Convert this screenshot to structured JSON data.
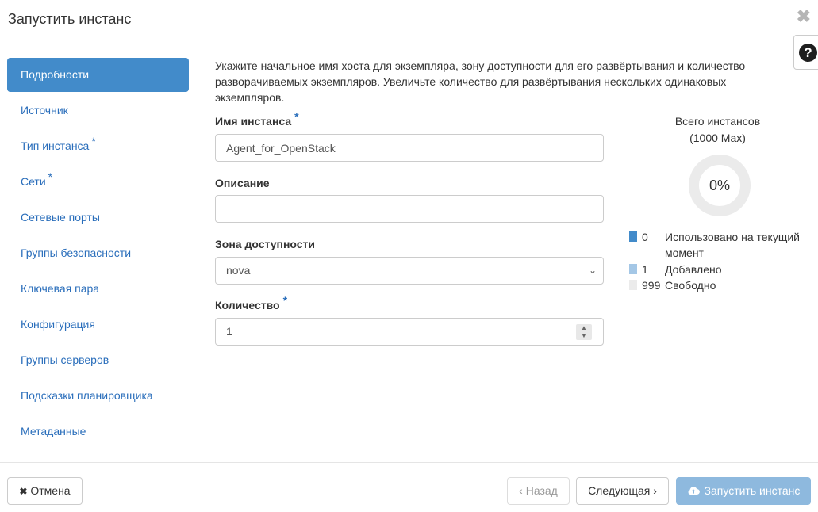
{
  "header": {
    "title": "Запустить инстанс",
    "close_glyph": "✖",
    "help_glyph": "?"
  },
  "sidebar": {
    "items": [
      {
        "label": "Подробности",
        "required": false,
        "active": true
      },
      {
        "label": "Источник",
        "required": false
      },
      {
        "label": "Тип инстанса",
        "required": true
      },
      {
        "label": "Сети",
        "required": true
      },
      {
        "label": "Сетевые порты",
        "required": false
      },
      {
        "label": "Группы безопасности",
        "required": false
      },
      {
        "label": "Ключевая пара",
        "required": false
      },
      {
        "label": "Конфигурация",
        "required": false
      },
      {
        "label": "Группы серверов",
        "required": false
      },
      {
        "label": "Подсказки планировщика",
        "required": false
      },
      {
        "label": "Метаданные",
        "required": false
      }
    ],
    "required_mark": "*"
  },
  "main": {
    "description": "Укажите начальное имя хоста для экземпляра, зону доступности для его развёртывания и количество разворачиваемых экземпляров. Увеличьте количество для развёртывания нескольких одинаковых экземпляров.",
    "fields": {
      "name": {
        "label": "Имя инстанса",
        "required": true,
        "value": "Agent_for_OpenStack"
      },
      "description": {
        "label": "Описание",
        "value": ""
      },
      "zone": {
        "label": "Зона доступности",
        "value": "nova",
        "arrow_glyph": "⌄"
      },
      "count": {
        "label": "Количество",
        "required": true,
        "value": "1",
        "up_glyph": "▲",
        "down_glyph": "▼"
      }
    }
  },
  "quota": {
    "title_line1": "Всего инстансов",
    "title_line2": "(1000 Max)",
    "percent_label": "0%",
    "used_fraction": 0.0,
    "legend": [
      {
        "value": "0",
        "label": "Использовано на текущий момент",
        "color": "#428bca"
      },
      {
        "value": "1",
        "label": "Добавлено",
        "color": "#a4c7e6"
      },
      {
        "value": "999",
        "label": "Свободно",
        "color": "#ebebeb"
      }
    ]
  },
  "footer": {
    "cancel_label": "Отмена",
    "cancel_icon": "✖",
    "back_label": "‹ Назад",
    "next_label": "Следующая ›",
    "launch_label": "Запустить инстанс",
    "launch_icon": "cloud-upload-icon"
  },
  "colors": {
    "accent": "#428bca",
    "link": "#2a6ebb",
    "primary_disabled": "#8eb9de"
  }
}
